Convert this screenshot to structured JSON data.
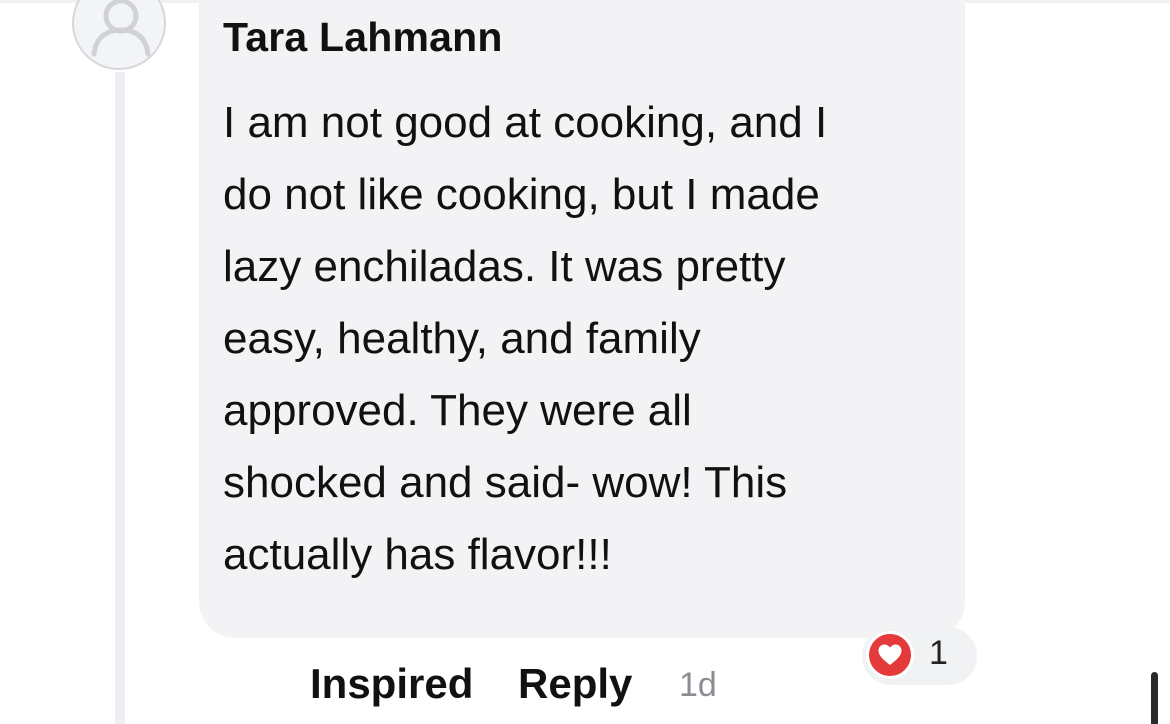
{
  "comment": {
    "author": "Tara Lahmann",
    "text_lines": [
      "I am not good at cooking, and I",
      "do not like cooking, but I made",
      "lazy enchiladas. It was pretty",
      "easy, healthy, and family",
      "approved. They were all",
      "shocked and said- wow! This",
      "actually has flavor!!!"
    ],
    "avatar_icon": "default-user-icon",
    "reaction": {
      "icon": "heart-icon",
      "count": "1",
      "color": "#e53a3c"
    },
    "actions": {
      "inspired_label": "Inspired",
      "reply_label": "Reply"
    },
    "timestamp": "1d"
  }
}
